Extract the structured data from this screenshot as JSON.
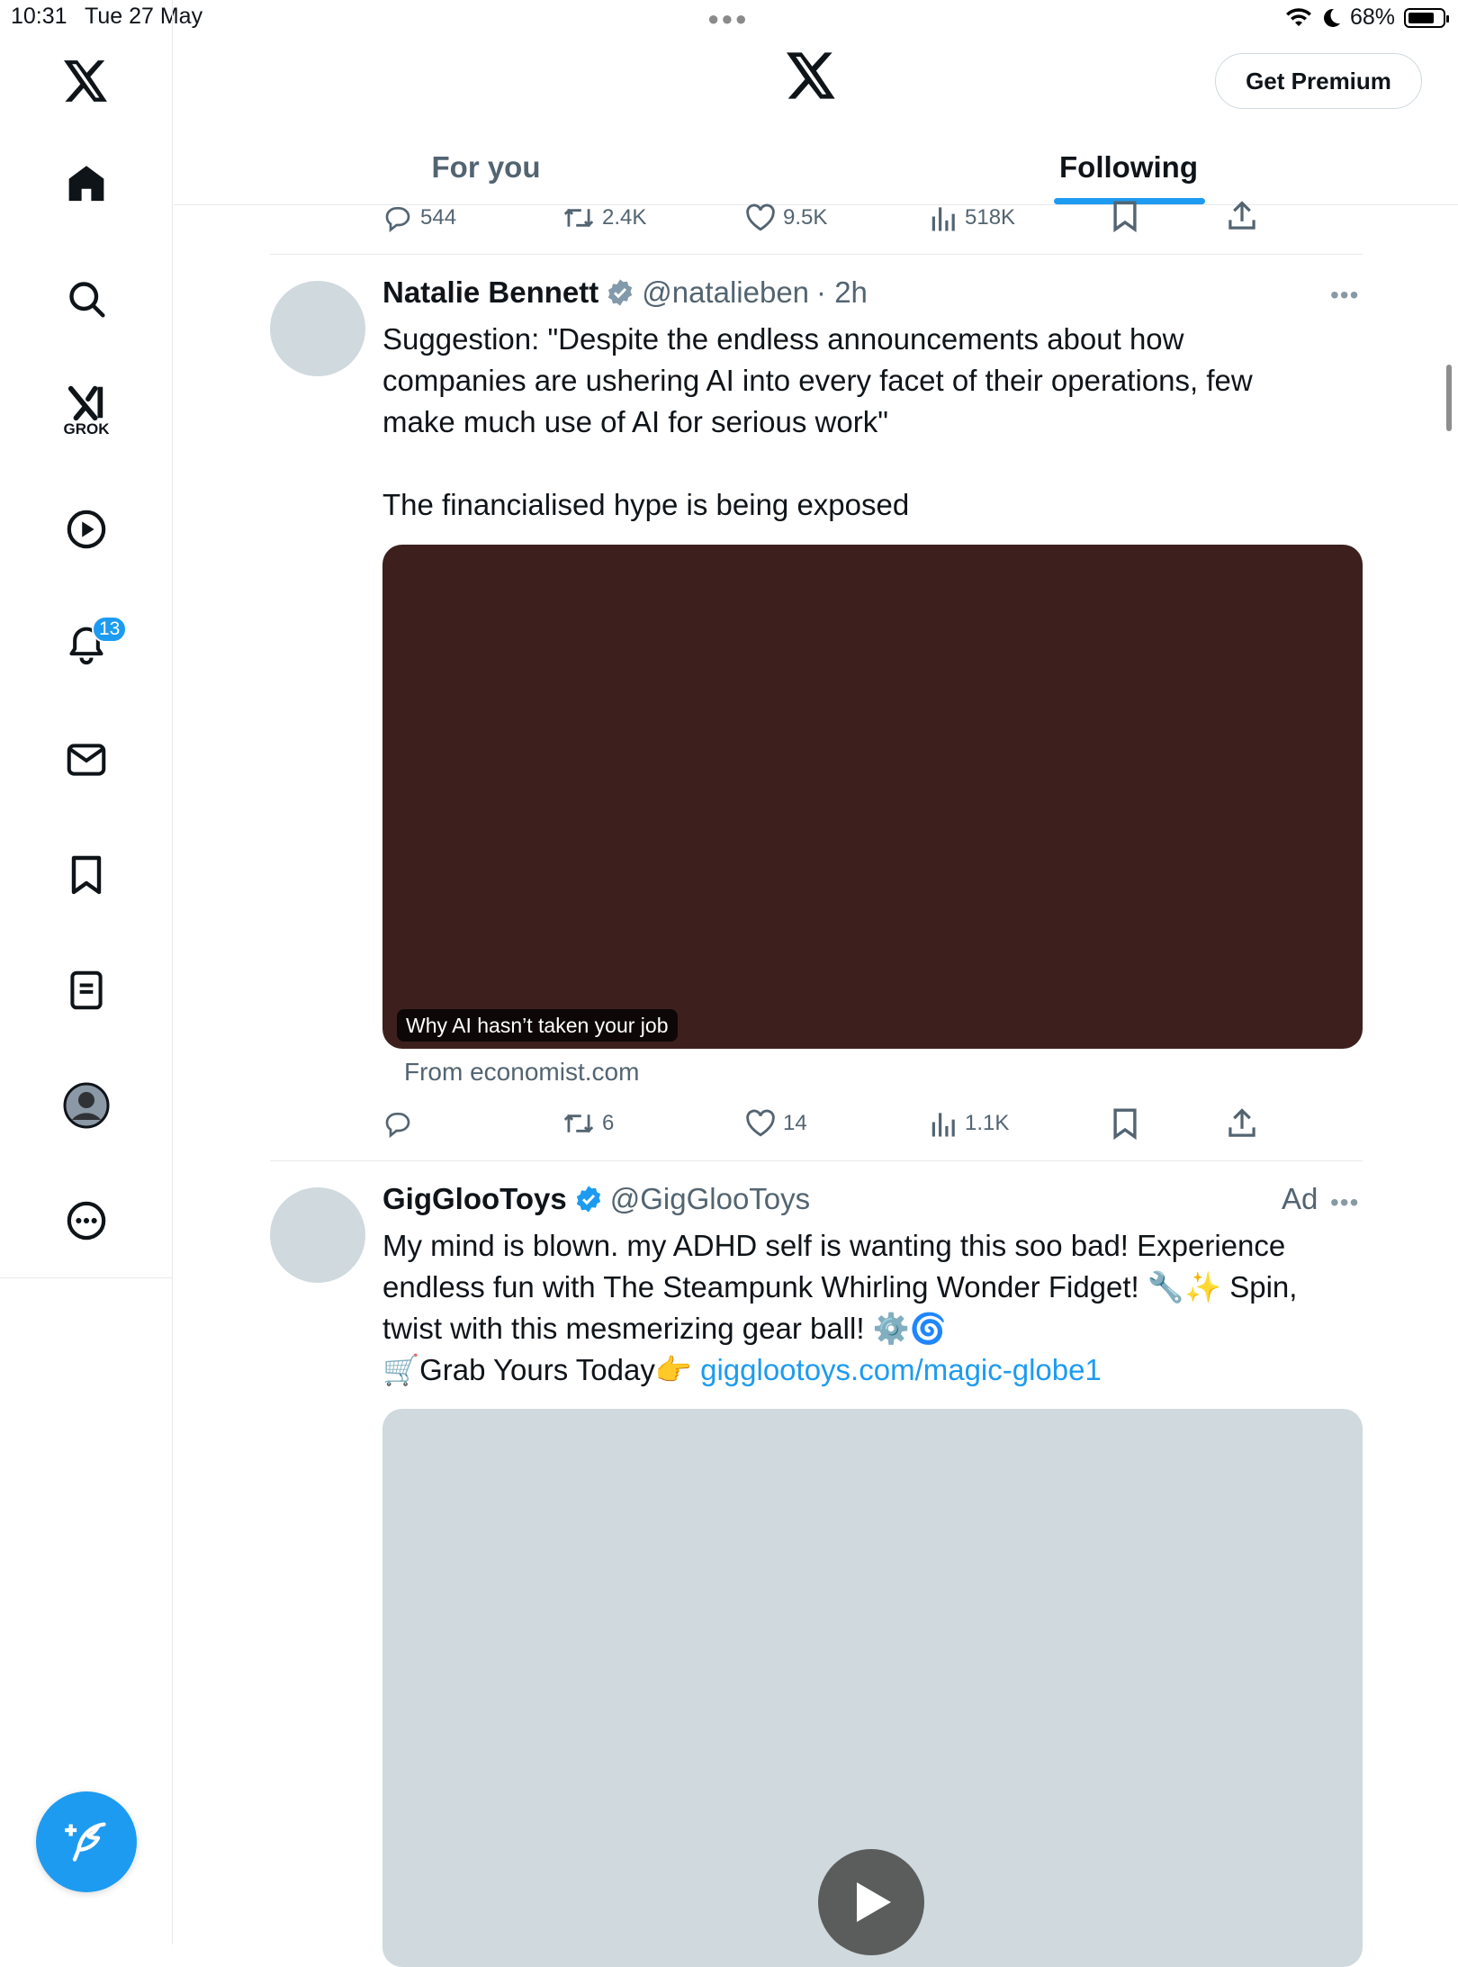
{
  "status_bar": {
    "time": "10:31",
    "date": "Tue 27 May",
    "battery": "68%"
  },
  "sidebar": {
    "grok_label": "GROK",
    "notifications_badge": "13"
  },
  "header": {
    "premium_label": "Get Premium",
    "tabs": [
      {
        "label": "For you",
        "active": false
      },
      {
        "label": "Following",
        "active": true
      }
    ]
  },
  "prev_tweet_actions": {
    "replies": "544",
    "reposts": "2.4K",
    "likes": "9.5K",
    "views": "518K"
  },
  "tweets": [
    {
      "name": "Natalie Bennett",
      "handle": "@natalieben",
      "time": "· 2h",
      "text_lines": [
        "Suggestion: \"Despite the endless announcements about how",
        "companies are ushering AI into every facet of their operations, few",
        "make much use of AI for serious work\"",
        "",
        "The financialised hype is being exposed"
      ],
      "card": {
        "caption": "Why AI hasn’t taken your job",
        "source": "From economist.com"
      },
      "actions": {
        "replies": "",
        "reposts": "6",
        "likes": "14",
        "views": "1.1K"
      }
    },
    {
      "name": "GigGlooToys",
      "handle": "@GigGlooToys",
      "ad_label": "Ad",
      "text_lines": [
        "My mind is blown. my ADHD self is wanting this soo bad! Experience",
        "endless fun with The Steampunk Whirling Wonder Fidget! 🔧✨ Spin,",
        "twist with this mesmerizing gear ball! ⚙️🌀",
        "🛒Grab Yours Today👉 "
      ],
      "link": "gigglootoys.com/magic-globe1"
    }
  ],
  "colors": {
    "accent": "#1d9bf0",
    "card_bg": "#3d201e",
    "muted": "#536471"
  }
}
